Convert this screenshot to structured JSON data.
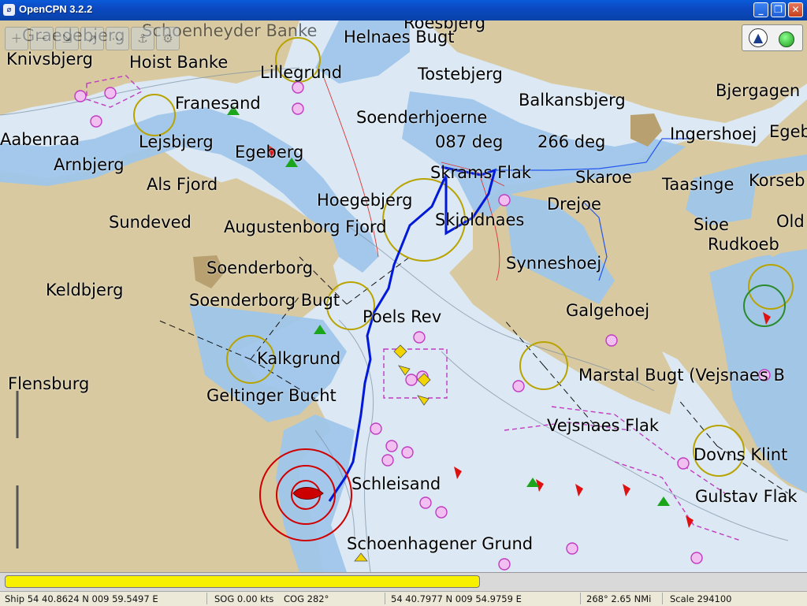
{
  "window": {
    "title": "OpenCPN 3.2.2",
    "minimize_label": "_",
    "maximize_label": "❐",
    "close_label": "✕"
  },
  "toolbar": {
    "buttons": [
      "zoom-in-icon",
      "zoom-out-icon",
      "scale-in-icon",
      "route-icon",
      "track-icon",
      "anchor-icon",
      "settings-icon"
    ]
  },
  "compass": {
    "north_glyph": "▲"
  },
  "map": {
    "heading_labels": {
      "a": "087 deg",
      "b": "266 deg"
    },
    "places": {
      "graedebjerg": "Graedebjerg",
      "schoenheyder_banke": "Schoenheyder Banke",
      "roesbjerg": "Roesbjerg",
      "knivsbjerg": "Knivsbjerg",
      "hoist_banke": "Hoist Banke",
      "helnaes_bugt": "Helnaes Bugt",
      "lillegrund": "Lillegrund",
      "tostebjerg": "Tostebjerg",
      "franesand": "Franesand",
      "balkansbjerg": "Balkansbjerg",
      "bjergagen": "Bjergagen",
      "soenderhjoerne": "Soenderhjoerne",
      "aabenraa": "Aabenraa",
      "lejsbjerg": "Lejsbjerg",
      "egeberg": "Egeberg",
      "ingershoej": "Ingershoej",
      "egeb": "Egeb",
      "arnbjerg": "Arnbjerg",
      "skrams_flak": "Skrams Flak",
      "skaroe": "Skaroe",
      "taasinge": "Taasinge",
      "korseb": "Korseb",
      "als_fjord": "Als Fjord",
      "hoegebjerg": "Hoegebjerg",
      "drejoe": "Drejoe",
      "skjoldnaes": "Skjoldnaes",
      "sundeved": "Sundeved",
      "augustenborg_fjord": "Augustenborg Fjord",
      "sioe": "Sioe",
      "old": "Old",
      "rudkoeb": "Rudkoeb",
      "synneshoej": "Synneshoej",
      "soenderborg": "Soenderborg",
      "keldbjerg": "Keldbjerg",
      "soenderborg_bugt": "Soenderborg Bugt",
      "poels_rev": "Poels Rev",
      "galgehoej": "Galgehoej",
      "kalkgrund": "Kalkgrund",
      "marstal_bugt": "Marstal Bugt (Vejsnaes B",
      "flensburg": "Flensburg",
      "geltinger_bucht": "Geltinger Bucht",
      "vejsnaes_flak": "Vejsnaes Flak",
      "dovns_klint": "Dovns Klint",
      "schleisand": "Schleisand",
      "gulstav_flak": "Gulstav Flak",
      "schoenhagener_grund": "Schoenhagener Grund"
    }
  },
  "colors": {
    "land": "#d8c9a0",
    "shallow_water": "#9fc6ea",
    "deep_water": "#dce9f4",
    "route": "#0018d8",
    "ownship": "#cc0000",
    "piano_key": "#f7f000"
  },
  "status": {
    "ship": "Ship 54 40.8624 N   009 59.5497 E",
    "sog": "SOG 0.00 kts",
    "cog": "COG 282°",
    "cursor": "54 40.7977 N   009 54.9759 E",
    "bearing": "268°  2.65 NMi",
    "scale": "Scale 294100"
  }
}
